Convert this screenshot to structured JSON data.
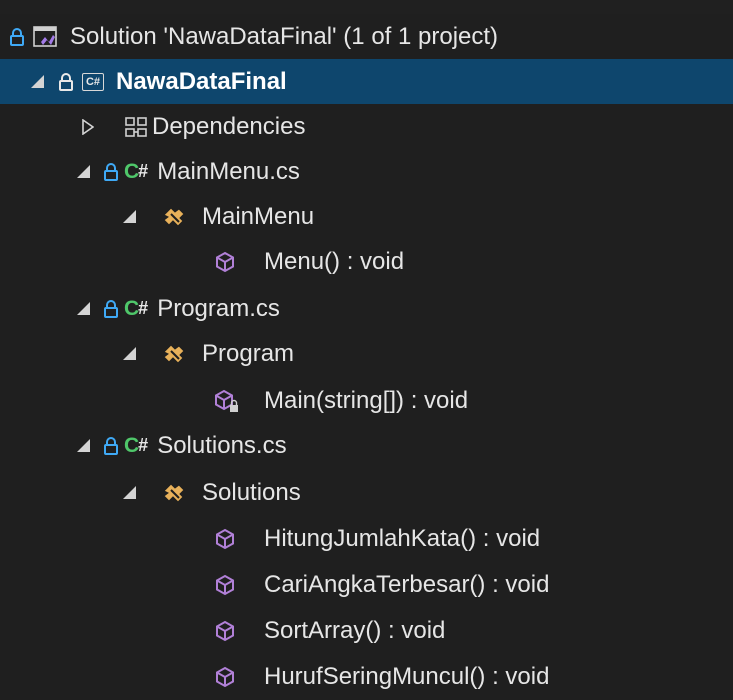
{
  "colors": {
    "background": "#1f1f1f",
    "selected_row": "#0e466d",
    "text": "#e6e6e6",
    "lock": "#3fa9f5",
    "csharp": "#4fc76a",
    "method": "#b180d7",
    "class": "#e8b15a"
  },
  "tree": {
    "solution": {
      "label": "Solution 'NawaDataFinal' (1 of 1 project)",
      "icon": "solution-icon"
    },
    "project": {
      "label": "NawaDataFinal",
      "icon": "csharp-project-icon"
    },
    "dependencies": {
      "label": "Dependencies",
      "icon": "dependencies-icon"
    },
    "files": [
      {
        "label": "MainMenu.cs",
        "class": {
          "label": "MainMenu",
          "methods": [
            {
              "label": "Menu() : void"
            }
          ]
        }
      },
      {
        "label": "Program.cs",
        "class": {
          "label": "Program",
          "methods": [
            {
              "label": "Main(string[]) : void"
            }
          ]
        }
      },
      {
        "label": "Solutions.cs",
        "class": {
          "label": "Solutions",
          "methods": [
            {
              "label": "HitungJumlahKata() : void"
            },
            {
              "label": "CariAngkaTerbesar() : void"
            },
            {
              "label": "SortArray() : void"
            },
            {
              "label": "HurufSeringMuncul() : void"
            }
          ]
        }
      }
    ]
  }
}
